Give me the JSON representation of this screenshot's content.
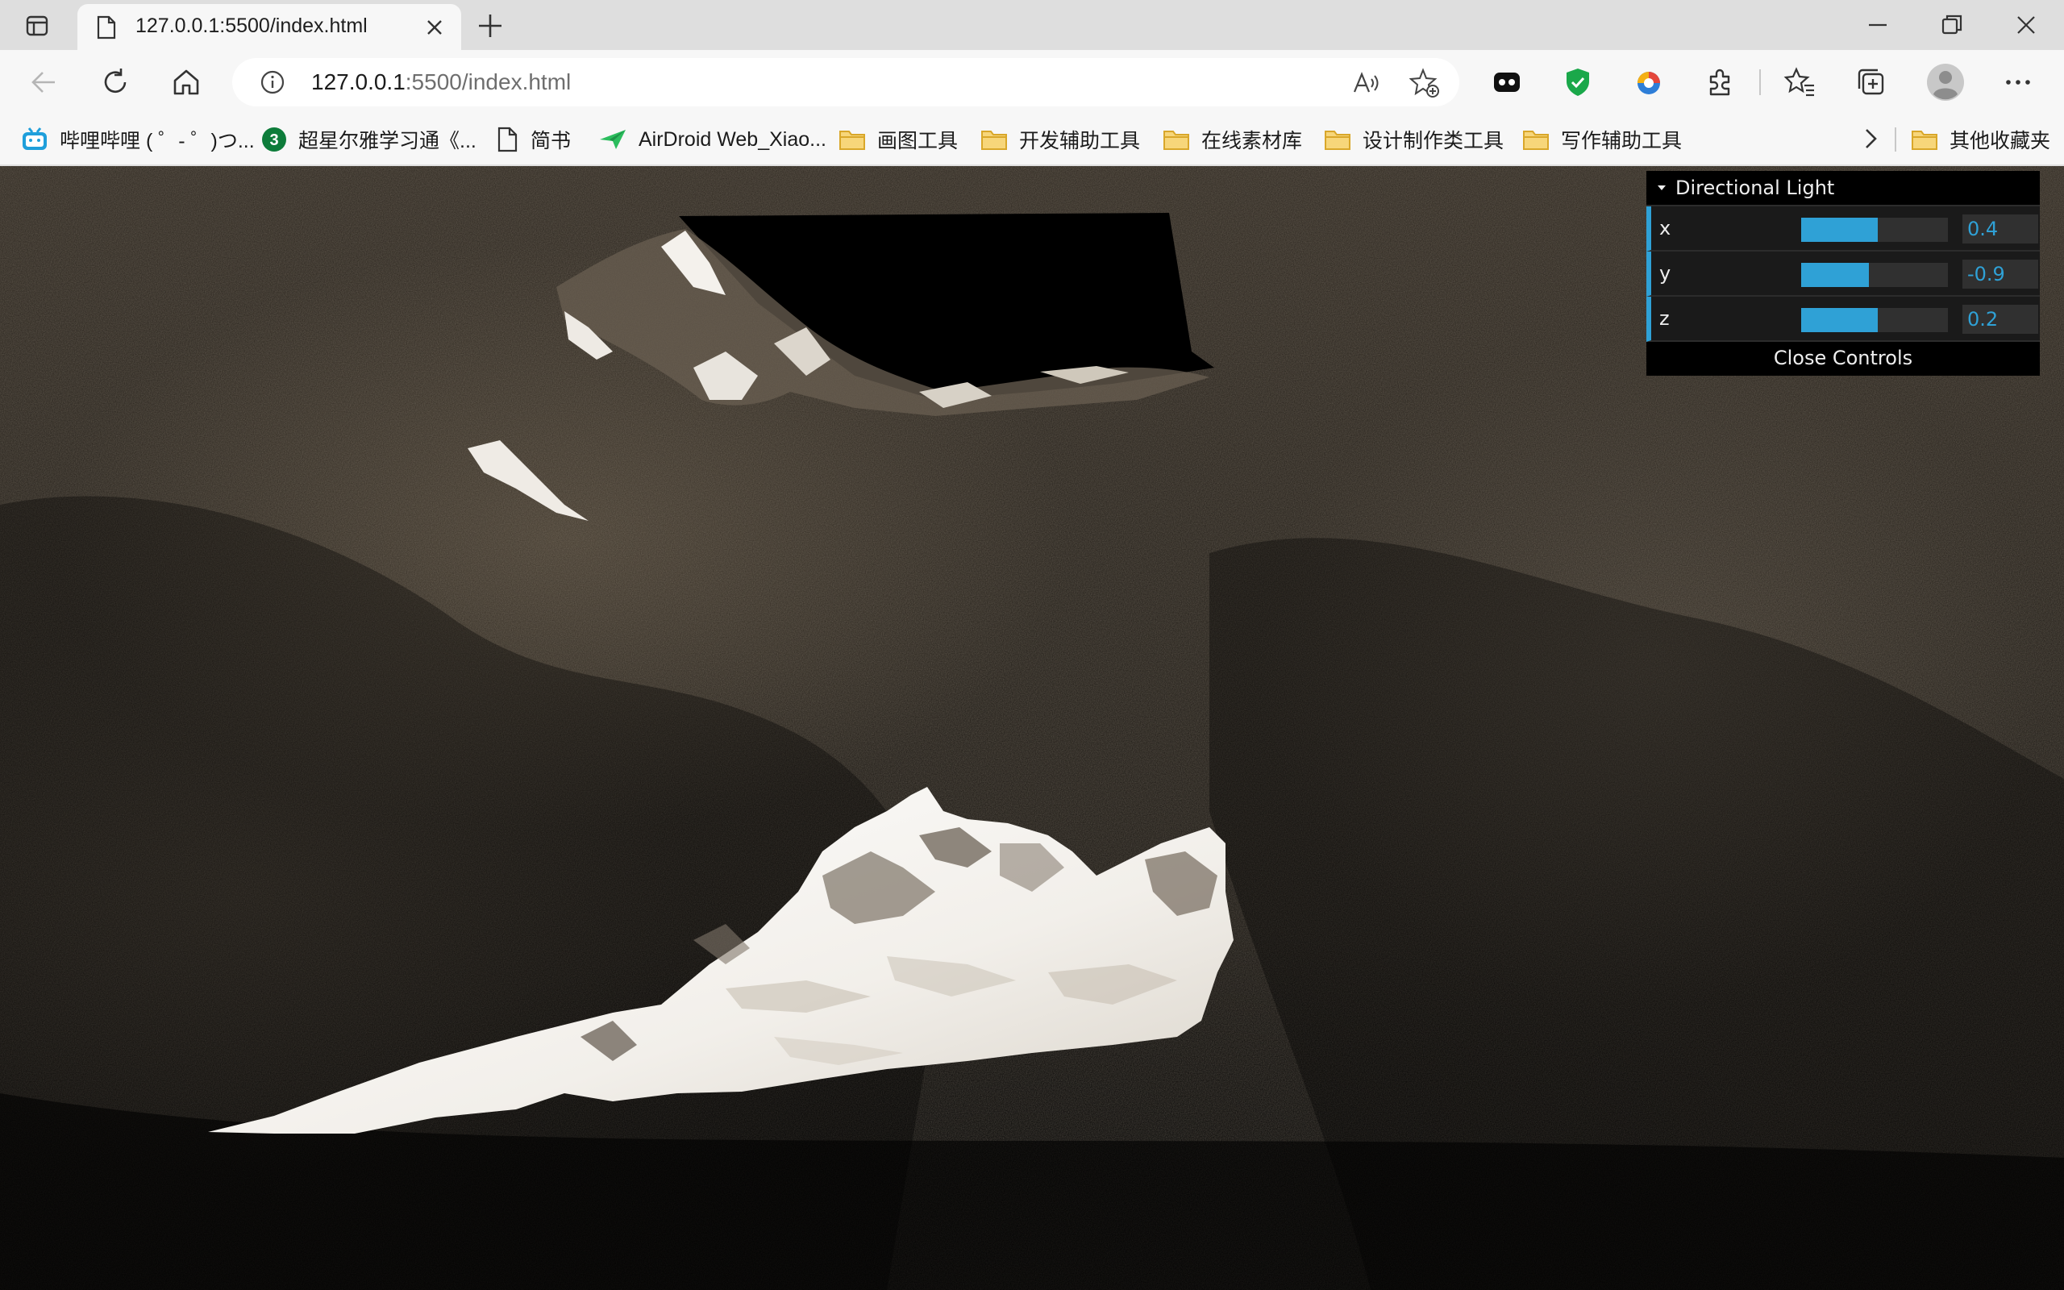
{
  "tab": {
    "title": "127.0.0.1:5500/index.html"
  },
  "address_bar": {
    "url_host": "127.0.0.1",
    "url_path": ":5500/index.html"
  },
  "favorites": [
    {
      "label": "哔哩哔哩 ( ゜- ゜)つ...",
      "icon": "bilibili-icon"
    },
    {
      "label": "超星尔雅学习通《...",
      "icon": "chaoxing-icon"
    },
    {
      "label": "简书",
      "icon": "document-icon"
    },
    {
      "label": "AirDroid Web_Xiao...",
      "icon": "airdroid-icon"
    },
    {
      "label": "画图工具",
      "icon": "folder-icon"
    },
    {
      "label": "开发辅助工具",
      "icon": "folder-icon"
    },
    {
      "label": "在线素材库",
      "icon": "folder-icon"
    },
    {
      "label": "设计制作类工具",
      "icon": "folder-icon"
    },
    {
      "label": "写作辅助工具",
      "icon": "folder-icon"
    }
  ],
  "other_favorites": "其他收藏夹",
  "gui": {
    "folder_title": "Directional Light",
    "controls": [
      {
        "label": "x",
        "value": "0.4",
        "fill": 0.52
      },
      {
        "label": "y",
        "value": "-0.9",
        "fill": 0.46
      },
      {
        "label": "z",
        "value": "0.2",
        "fill": 0.52
      }
    ],
    "close_label": "Close Controls",
    "accent_color": "#2fa1d6"
  }
}
